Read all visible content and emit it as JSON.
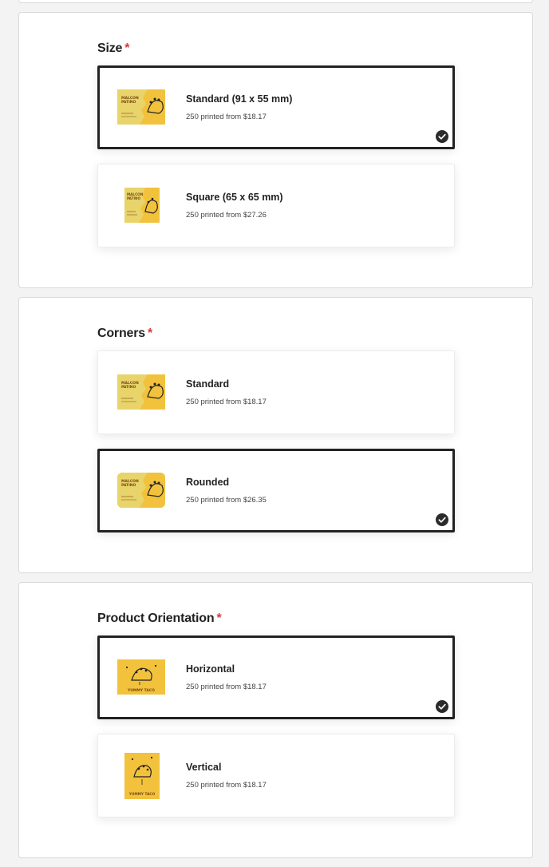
{
  "sections": [
    {
      "title": "Size",
      "required_mark": "*",
      "options": [
        {
          "label": "Standard (91 x 55 mm)",
          "sub": "250 printed from $18.17",
          "selected": true
        },
        {
          "label": "Square (65 x 65 mm)",
          "sub": "250 printed from $27.26",
          "selected": false
        }
      ]
    },
    {
      "title": "Corners",
      "required_mark": "*",
      "options": [
        {
          "label": "Standard",
          "sub": "250 printed from $18.17",
          "selected": false
        },
        {
          "label": "Rounded",
          "sub": "250 printed from $26.35",
          "selected": true
        }
      ]
    },
    {
      "title": "Product Orientation",
      "required_mark": "*",
      "options": [
        {
          "label": "Horizontal",
          "sub": "250 printed from $18.17",
          "selected": true
        },
        {
          "label": "Vertical",
          "sub": "250 printed from $18.17",
          "selected": false
        }
      ]
    }
  ],
  "thumb_text": {
    "brand_line1": "MALCON",
    "brand_line2": "PATINO",
    "taco_caption": "YUMMY TACO"
  },
  "colors": {
    "card_yellow": "#f2c23c",
    "card_light": "#e8d46a",
    "selected_border": "#222222",
    "required": "#d93a3a"
  },
  "icons": {
    "thumb": "business-card-thumbnail",
    "check": "checkmark-circle-icon"
  }
}
